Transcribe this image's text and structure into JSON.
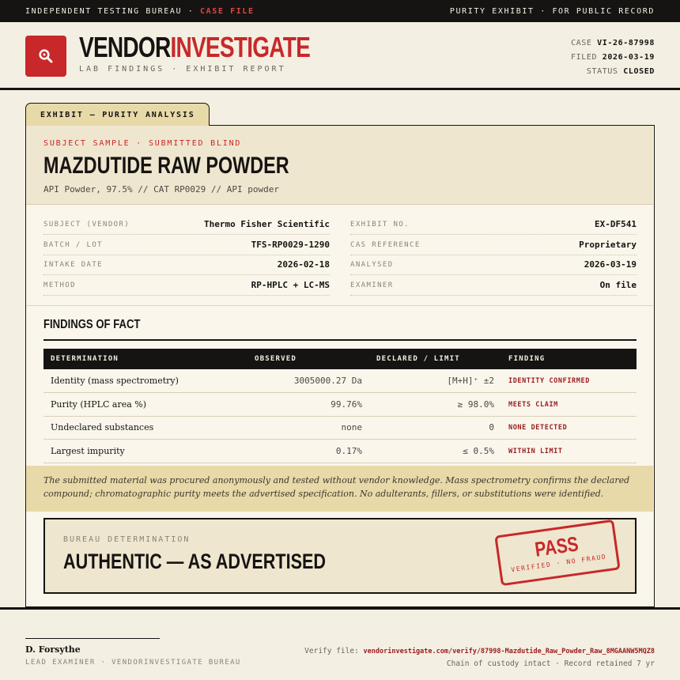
{
  "topbar": {
    "left_prefix": "INDEPENDENT TESTING BUREAU · ",
    "left_accent": "CASE FILE",
    "right": "PURITY EXHIBIT · FOR PUBLIC RECORD"
  },
  "header": {
    "logo_icon": "magnifier-icon",
    "brand_part1": "VENDOR",
    "brand_part2": "INVESTIGATE",
    "subtitle": "LAB FINDINGS · EXHIBIT REPORT",
    "case_label": "CASE",
    "case_value": "VI-26-87998",
    "filed_label": "FILED",
    "filed_value": "2026-03-19",
    "status_label": "STATUS",
    "status_value": "CLOSED"
  },
  "tab": {
    "label": "EXHIBIT — PURITY ANALYSIS"
  },
  "subject": {
    "eyebrow": "SUBJECT SAMPLE · SUBMITTED BLIND",
    "title": "MAZDUTIDE RAW POWDER",
    "description": "API Powder, 97.5%  //  CAT RP0029  //  API powder"
  },
  "metadata": [
    {
      "key": "SUBJECT (VENDOR)",
      "value": "Thermo Fisher Scientific"
    },
    {
      "key": "EXHIBIT NO.",
      "value": "EX-DF541"
    },
    {
      "key": "BATCH / LOT",
      "value": "TFS-RP0029-1290"
    },
    {
      "key": "CAS REFERENCE",
      "value": "Proprietary"
    },
    {
      "key": "INTAKE DATE",
      "value": "2026-02-18"
    },
    {
      "key": "ANALYSED",
      "value": "2026-03-19"
    },
    {
      "key": "METHOD",
      "value": "RP-HPLC + LC-MS"
    },
    {
      "key": "EXAMINER",
      "value": "On file"
    }
  ],
  "findings": {
    "title": "FINDINGS OF FACT",
    "columns": [
      "DETERMINATION",
      "OBSERVED",
      "DECLARED / LIMIT",
      "FINDING"
    ],
    "rows": [
      {
        "determination": "Identity (mass spectrometry)",
        "observed": "3005000.27 Da",
        "declared": "[M+H]⁺ ±2",
        "finding": "IDENTITY CONFIRMED"
      },
      {
        "determination": "Purity (HPLC area %)",
        "observed": "99.76%",
        "declared": "≥ 98.0%",
        "finding": "MEETS CLAIM"
      },
      {
        "determination": "Undeclared substances",
        "observed": "none",
        "declared": "0",
        "finding": "NONE DETECTED"
      },
      {
        "determination": "Largest impurity",
        "observed": "0.17%",
        "declared": "≤ 0.5%",
        "finding": "WITHIN LIMIT"
      }
    ]
  },
  "narrative": "The submitted material was procured anonymously and tested without vendor knowledge. Mass spectrometry confirms the declared compound; chromatographic purity meets the advertised specification. No adulterants, fillers, or substitutions were identified.",
  "determination": {
    "eyebrow": "BUREAU DETERMINATION",
    "verdict": "AUTHENTIC — AS ADVERTISED",
    "stamp_main": "PASS",
    "stamp_sub": "VERIFIED · NO FRAUD"
  },
  "footer": {
    "signer": "D. Forsythe",
    "role": "LEAD EXAMINER · VENDORINVESTIGATE BUREAU",
    "verify_label": "Verify file: ",
    "verify_url": "vendorinvestigate.com/verify/87998-Mazdutide_Raw_Powder_Raw_8MGAANW5MQZ8",
    "custody": "Chain of custody intact · Record retained 7 yr"
  },
  "colors": {
    "accent": "#c8282a",
    "ink": "#161412",
    "paper": "#f4efe3",
    "band": "#e8d9a8"
  }
}
